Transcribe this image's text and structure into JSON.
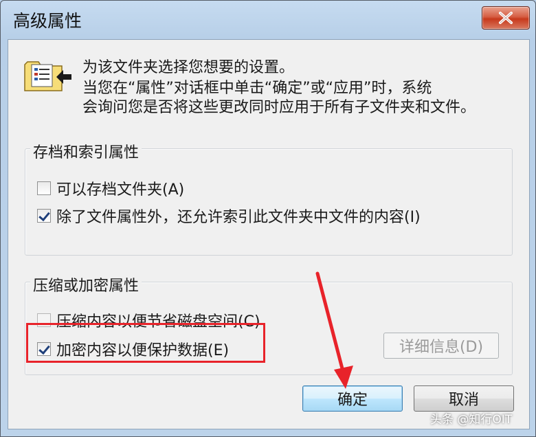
{
  "window": {
    "title": "高级属性",
    "close_icon": "close-icon"
  },
  "description": {
    "icon": "folder-attributes-icon",
    "line1": "为该文件夹选择您想要的设置。",
    "line2": "当您在“属性”对话框中单击“确定”或“应用”时，系统",
    "line3": "会询问您是否将这些更改同时应用于所有子文件夹和文件。"
  },
  "archive_group": {
    "label": "存档和索引属性",
    "options": [
      {
        "label": "可以存档文件夹(A)",
        "checked": false
      },
      {
        "label": "除了文件属性外，还允许索引此文件夹中文件的内容(I)",
        "checked": true
      }
    ]
  },
  "compress_group": {
    "label": "压缩或加密属性",
    "options": [
      {
        "label": "压缩内容以便节省磁盘空间(C)",
        "checked": false,
        "enabled": false
      },
      {
        "label": "加密内容以便保护数据(E)",
        "checked": true,
        "enabled": true
      }
    ],
    "details_button": "详细信息(D)"
  },
  "buttons": {
    "ok": "确定",
    "cancel": "取消"
  },
  "watermark": "头条 @知行OIT",
  "colors": {
    "highlight": "#e8232a",
    "close_button": "#c7391c",
    "default_button": "#3c7fb1"
  }
}
